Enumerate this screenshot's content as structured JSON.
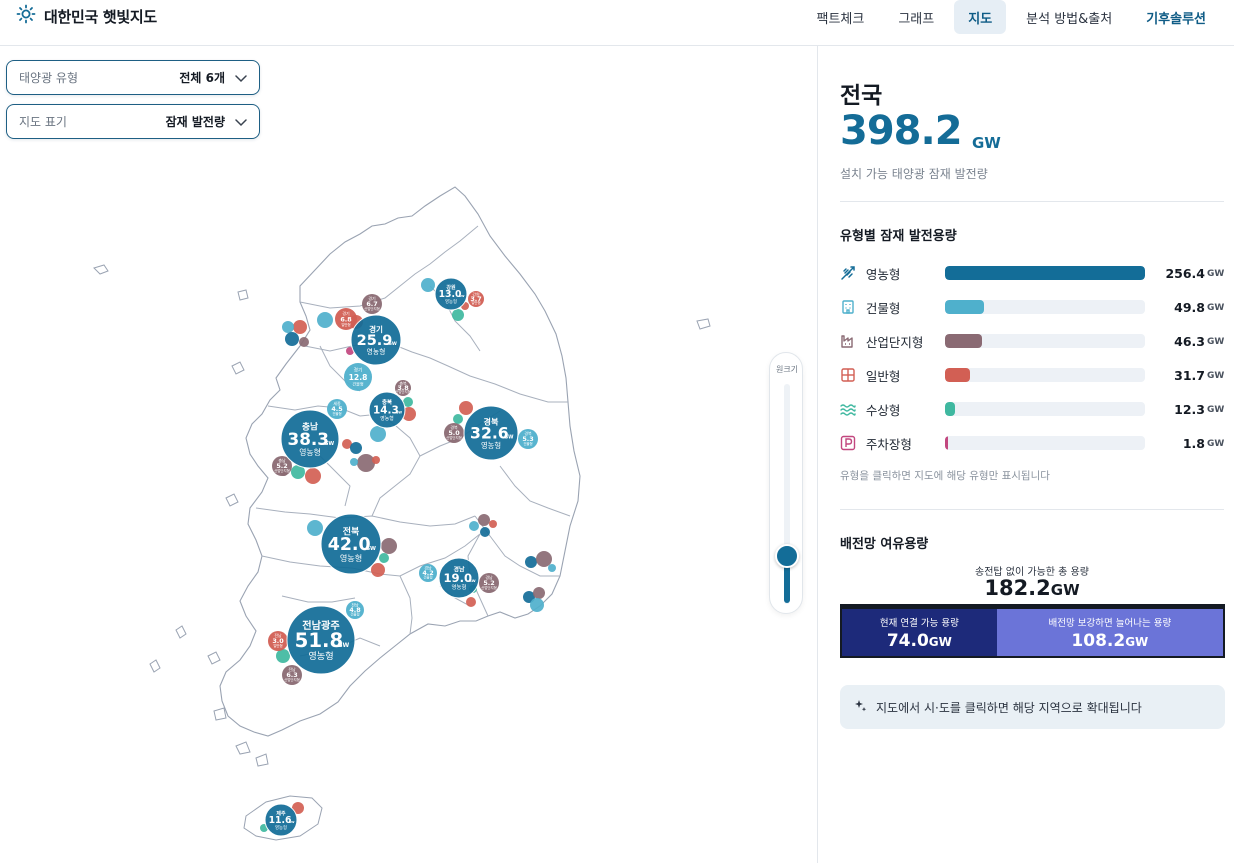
{
  "app": {
    "title": "대한민국 햇빛지도"
  },
  "nav": {
    "tabs": [
      {
        "label": "팩트체크"
      },
      {
        "label": "그래프"
      },
      {
        "label": "지도"
      },
      {
        "label": "분석 방법&출처"
      },
      {
        "label": "기후솔루션"
      }
    ],
    "active_index": 2
  },
  "filters": {
    "solar_type": {
      "label": "태양광 유형",
      "value": "전체 6개"
    },
    "map_display": {
      "label": "지도 표기",
      "value": "잠재 발전량"
    }
  },
  "zoom": {
    "label": "원크기",
    "level": 0.22
  },
  "summary": {
    "region": "전국",
    "value": "398.2",
    "unit": "GW",
    "description": "설치 가능 태양광 잠재 발전량"
  },
  "types": {
    "title": "유형별 잠재 발전용량",
    "unit": "GW",
    "items": [
      {
        "label": "영농형",
        "value": 256.4,
        "value_text": "256.4",
        "color": "#136d98",
        "icon": "wheat-icon"
      },
      {
        "label": "건물형",
        "value": 49.8,
        "value_text": "49.8",
        "color": "#4fb0cc",
        "icon": "building-icon"
      },
      {
        "label": "산업단지형",
        "value": 46.3,
        "value_text": "46.3",
        "color": "#8a6a73",
        "icon": "factory-icon"
      },
      {
        "label": "일반형",
        "value": 31.7,
        "value_text": "31.7",
        "color": "#d25f54",
        "icon": "solar-panel-icon"
      },
      {
        "label": "수상형",
        "value": 12.3,
        "value_text": "12.3",
        "color": "#3fb8a0",
        "icon": "water-icon"
      },
      {
        "label": "주차장형",
        "value": 1.8,
        "value_text": "1.8",
        "color": "#c2477f",
        "icon": "parking-icon"
      }
    ],
    "hint": "유형을 클릭하면 지도에 해당 유형만 표시됩니다"
  },
  "grid": {
    "title": "배전망 여유용량",
    "total_label": "송전탑 없이 가능한 총 용량",
    "total_value": "182.2",
    "unit": "GW",
    "segments": [
      {
        "label": "현재 연결 가능 용량",
        "value": "74.0",
        "amount": 74.0,
        "color": "#1d2a7a"
      },
      {
        "label": "배전망 보강하면 늘어나는 용량",
        "value": "108.2",
        "amount": 108.2,
        "color": "#6b74d8"
      }
    ]
  },
  "notice": {
    "text": "지도에서 시·도를 클릭하면 해당 지역으로 확대됩니다",
    "icon": "sparkle-icon"
  },
  "map": {
    "main_type": "영농형",
    "unit": "GW",
    "regions": [
      {
        "name": "경기",
        "value": "25.9"
      },
      {
        "name": "강원",
        "value": "13.0"
      },
      {
        "name": "충남",
        "value": "38.3"
      },
      {
        "name": "충북",
        "value": "14.3"
      },
      {
        "name": "경북",
        "value": "32.6"
      },
      {
        "name": "전북",
        "value": "42.0"
      },
      {
        "name": "경남",
        "value": "19.0"
      },
      {
        "name": "전남광주",
        "value": "51.8"
      },
      {
        "name": "제주",
        "value": "11.6"
      }
    ],
    "secondary": [
      {
        "name": "경기",
        "value": "12.8",
        "type": "건물형",
        "color": "#4fb0cc"
      },
      {
        "name": "경기",
        "value": "6.8",
        "type": "일반형",
        "color": "#d25f54"
      },
      {
        "name": "경기",
        "value": "6.7",
        "type": "산업단지형",
        "color": "#8a6a73"
      },
      {
        "name": "강원",
        "value": "3.7",
        "type": "일반형",
        "color": "#d25f54"
      },
      {
        "name": "충남",
        "value": "5.2",
        "type": "산업단지형",
        "color": "#8a6a73"
      },
      {
        "name": "세종",
        "value": "4.5",
        "type": "건물형",
        "color": "#4fb0cc"
      },
      {
        "name": "충북",
        "value": "3.8",
        "type": "산업단지형",
        "color": "#8a6a73"
      },
      {
        "name": "경북",
        "value": "5.0",
        "type": "산업단지형",
        "color": "#8a6a73"
      },
      {
        "name": "경북",
        "value": "5.3",
        "type": "건물형",
        "color": "#4fb0cc"
      },
      {
        "name": "경남",
        "value": "4.2",
        "type": "건물형",
        "color": "#4fb0cc"
      },
      {
        "name": "경남",
        "value": "5.2",
        "type": "산업단지형",
        "color": "#8a6a73"
      },
      {
        "name": "전남",
        "value": "4.8",
        "type": "건물형",
        "color": "#4fb0cc"
      },
      {
        "name": "전남",
        "value": "3.0",
        "type": "일반형",
        "color": "#d25f54"
      },
      {
        "name": "전남",
        "value": "6.3",
        "type": "산업단지형",
        "color": "#8a6a73"
      }
    ]
  }
}
